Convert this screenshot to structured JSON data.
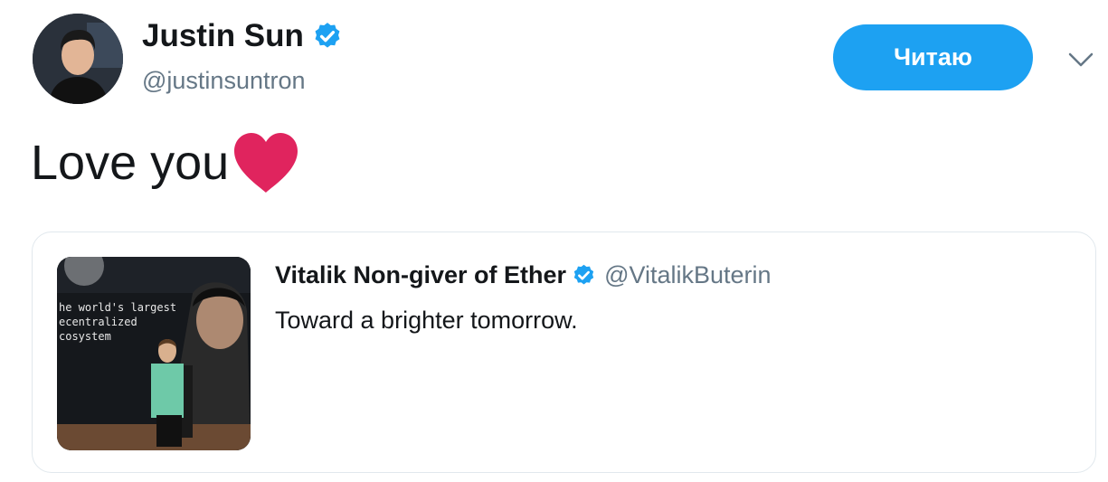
{
  "author": {
    "display_name": "Justin Sun",
    "handle": "@justinsuntron",
    "verified": true
  },
  "follow_button": {
    "label": "Читаю"
  },
  "tweet": {
    "text": "Love you",
    "emoji": "red-heart"
  },
  "quoted_tweet": {
    "display_name": "Vitalik Non-giver of Ether",
    "handle": "@VitalikButerin",
    "verified": true,
    "text": "Toward a brighter tomorrow.",
    "media": {
      "banner_lines": [
        "he world's largest",
        "ecentralized",
        "cosystem"
      ]
    }
  },
  "colors": {
    "accent": "#1da1f2",
    "heart": "#e0245e",
    "text": "#14171a",
    "muted": "#657786",
    "border": "#e1e8ed"
  },
  "icons": {
    "verified": "verified-badge-icon",
    "caret": "chevron-down-icon"
  }
}
